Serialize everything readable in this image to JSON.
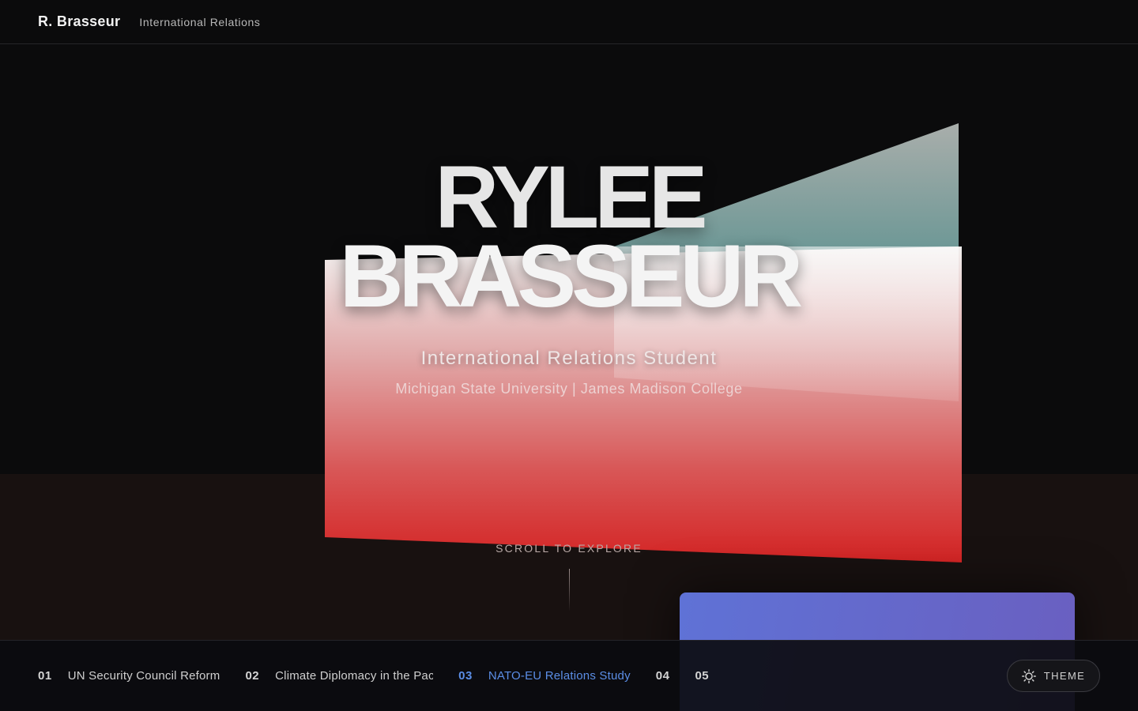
{
  "header": {
    "brand": "R. Brasseur",
    "subtitle": "International Relations"
  },
  "hero": {
    "first_name": "RYLEE",
    "last_name": "BRASSEUR",
    "role": "International Relations Student",
    "school": "Michigan State University | James Madison College"
  },
  "scroll_cue": "SCROLL TO EXPLORE",
  "projects": [
    {
      "num": "01",
      "title": "UN Security Council Reform",
      "active": false
    },
    {
      "num": "02",
      "title": "Climate Diplomacy in the Pacific",
      "active": false
    },
    {
      "num": "03",
      "title": "NATO-EU Relations Study",
      "active": true
    },
    {
      "num": "04",
      "title": "",
      "active": false
    },
    {
      "num": "05",
      "title": "",
      "active": false
    }
  ],
  "theme_button": {
    "label": "THEME",
    "icon": "sun-icon"
  },
  "colors": {
    "background": "#0b0b0c",
    "accent": "#5b8ee6",
    "plane_red": "#d42424",
    "plane_teal": "#6e9896",
    "card_gradient_start": "#5f72d6",
    "card_gradient_end": "#6a5fc0"
  }
}
